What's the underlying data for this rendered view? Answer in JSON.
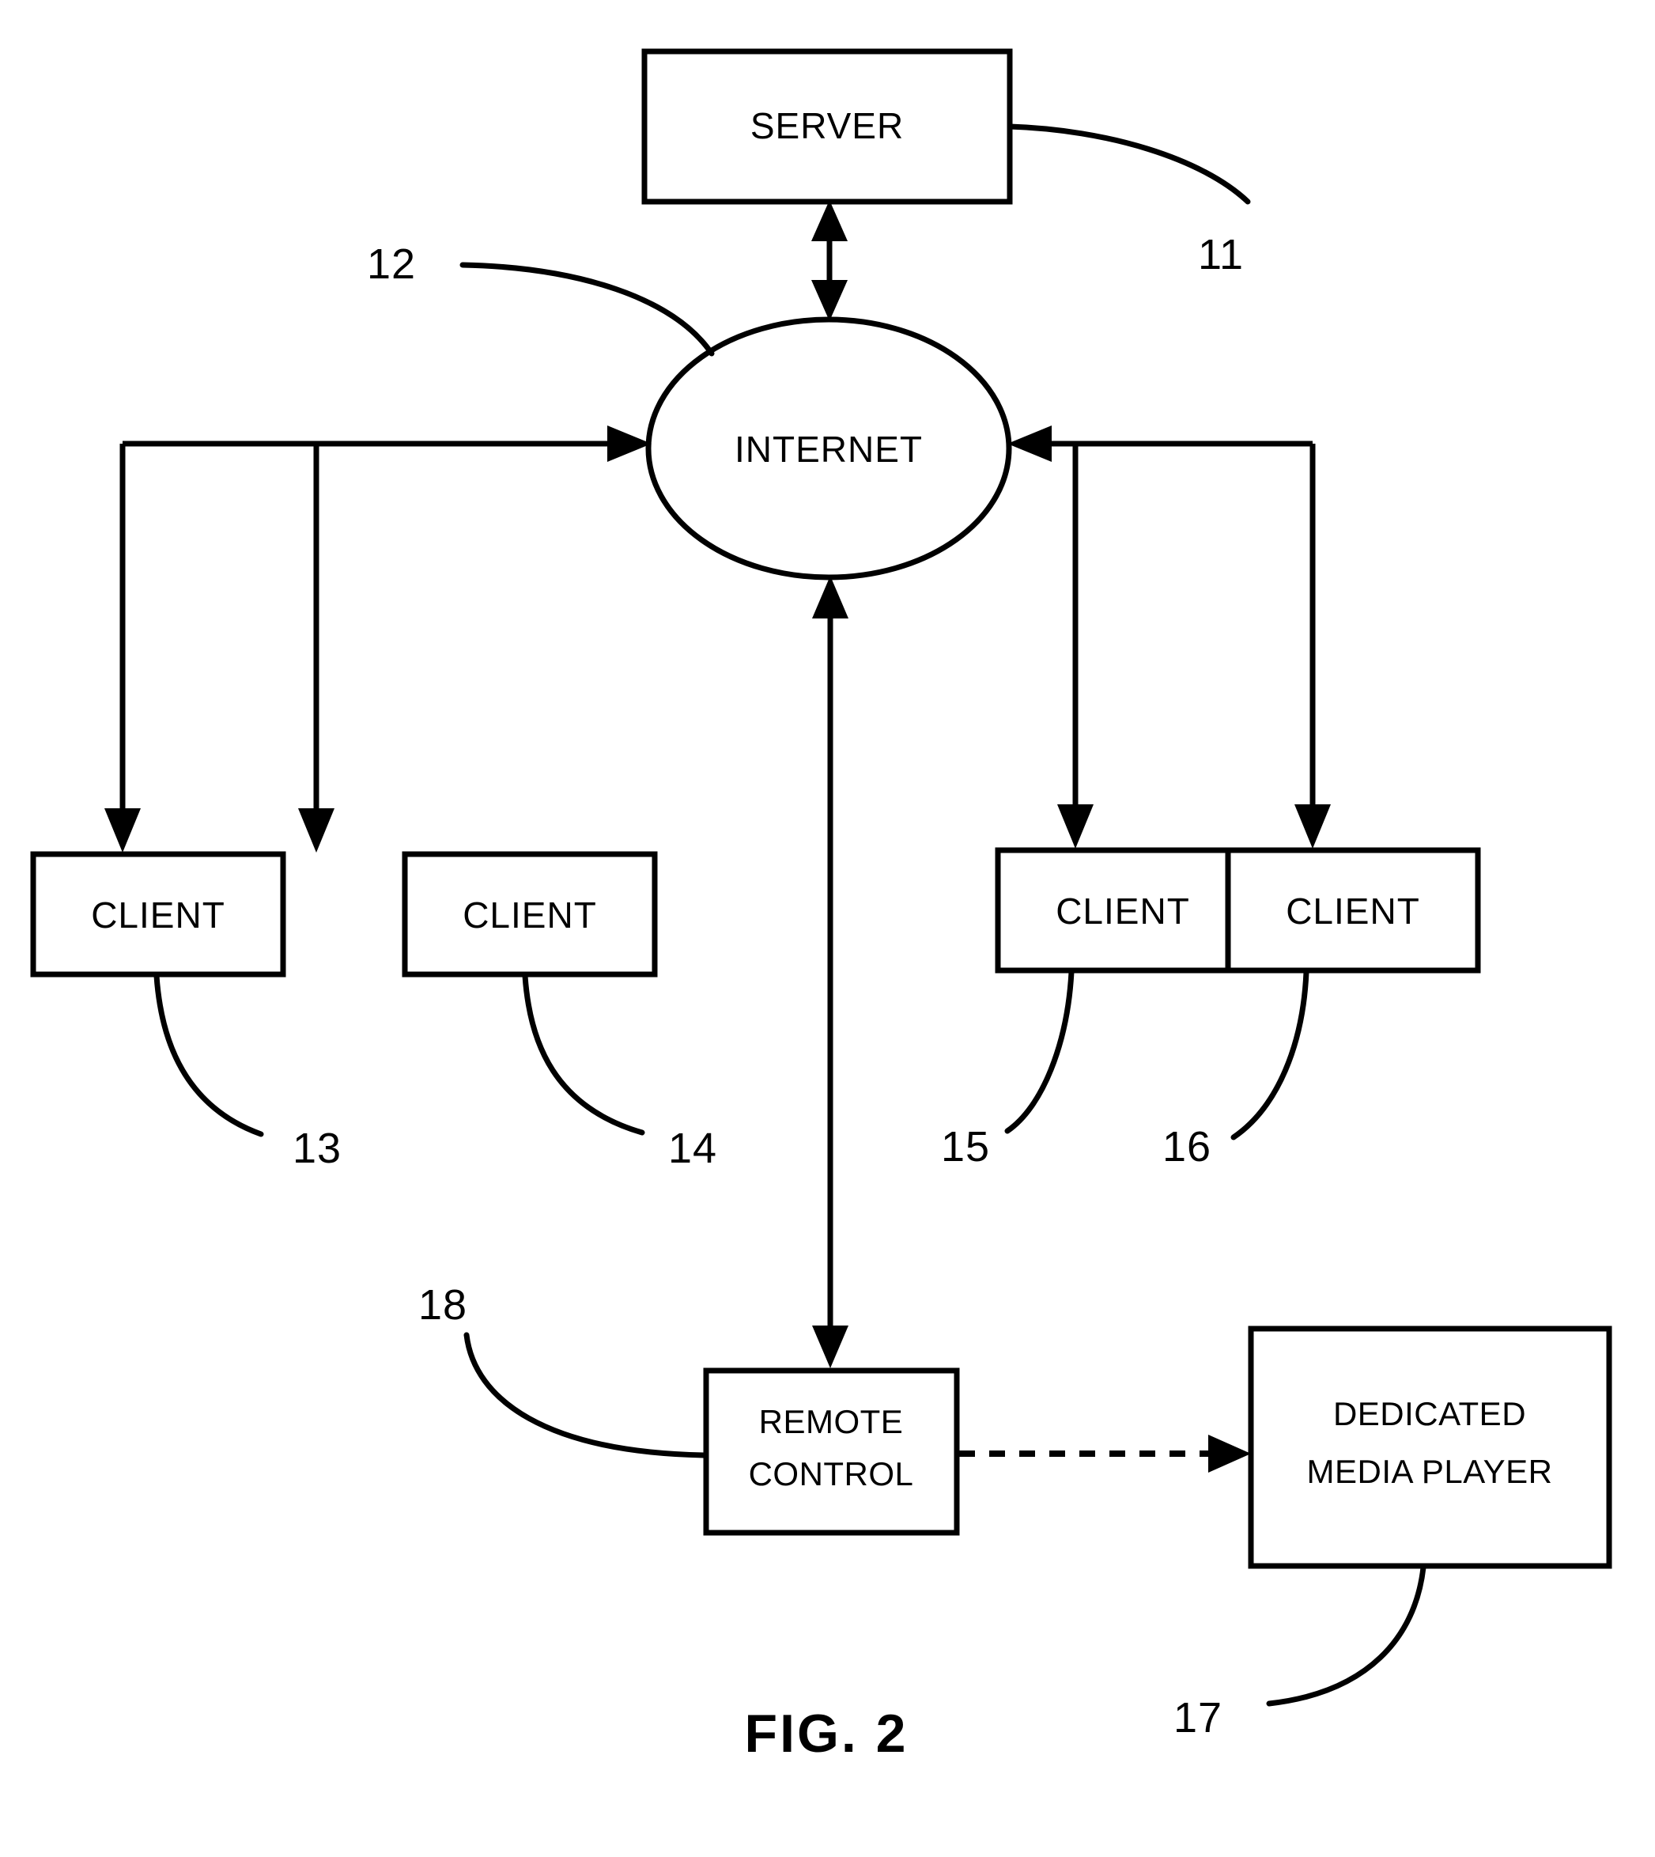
{
  "figure": {
    "caption": "FIG. 2",
    "title": "FIG. 2"
  },
  "nodes": {
    "server": {
      "label": "SERVER",
      "ref": "11"
    },
    "internet": {
      "label": "INTERNET",
      "ref": "12"
    },
    "client1": {
      "label": "CLIENT",
      "ref": "13"
    },
    "client2": {
      "label": "CLIENT",
      "ref": "14"
    },
    "client3": {
      "label": "CLIENT",
      "ref": "15"
    },
    "client4": {
      "label": "CLIENT",
      "ref": "16"
    },
    "remote_control": {
      "label_line1": "REMOTE",
      "label_line2": "CONTROL",
      "ref": "18"
    },
    "media_player": {
      "label_line1": "DEDICATED",
      "label_line2": "MEDIA PLAYER",
      "ref": "17"
    }
  },
  "reference_numerals": {
    "n11": "11",
    "n12": "12",
    "n13": "13",
    "n14": "14",
    "n15": "15",
    "n16": "16",
    "n17": "17",
    "n18": "18"
  },
  "colors": {
    "ink": "#000000",
    "paper": "#ffffff"
  },
  "chart_data": {
    "type": "diagram",
    "title": "FIG. 2",
    "nodes": [
      {
        "id": "11",
        "label": "SERVER",
        "shape": "rectangle"
      },
      {
        "id": "12",
        "label": "INTERNET",
        "shape": "ellipse"
      },
      {
        "id": "13",
        "label": "CLIENT",
        "shape": "rectangle"
      },
      {
        "id": "14",
        "label": "CLIENT",
        "shape": "rectangle"
      },
      {
        "id": "15",
        "label": "CLIENT",
        "shape": "rectangle"
      },
      {
        "id": "16",
        "label": "CLIENT",
        "shape": "rectangle"
      },
      {
        "id": "17",
        "label": "DEDICATED MEDIA PLAYER",
        "shape": "rectangle"
      },
      {
        "id": "18",
        "label": "REMOTE CONTROL",
        "shape": "rectangle"
      }
    ],
    "edges": [
      {
        "from": "11",
        "to": "12",
        "style": "solid",
        "arrows": "both"
      },
      {
        "from": "12",
        "to": "13",
        "style": "solid",
        "arrows": "both"
      },
      {
        "from": "12",
        "to": "14",
        "style": "solid",
        "arrows": "both"
      },
      {
        "from": "12",
        "to": "15",
        "style": "solid",
        "arrows": "both"
      },
      {
        "from": "12",
        "to": "16",
        "style": "solid",
        "arrows": "both"
      },
      {
        "from": "12",
        "to": "18",
        "style": "solid",
        "arrows": "both"
      },
      {
        "from": "18",
        "to": "17",
        "style": "dashed",
        "arrows": "forward"
      }
    ]
  }
}
